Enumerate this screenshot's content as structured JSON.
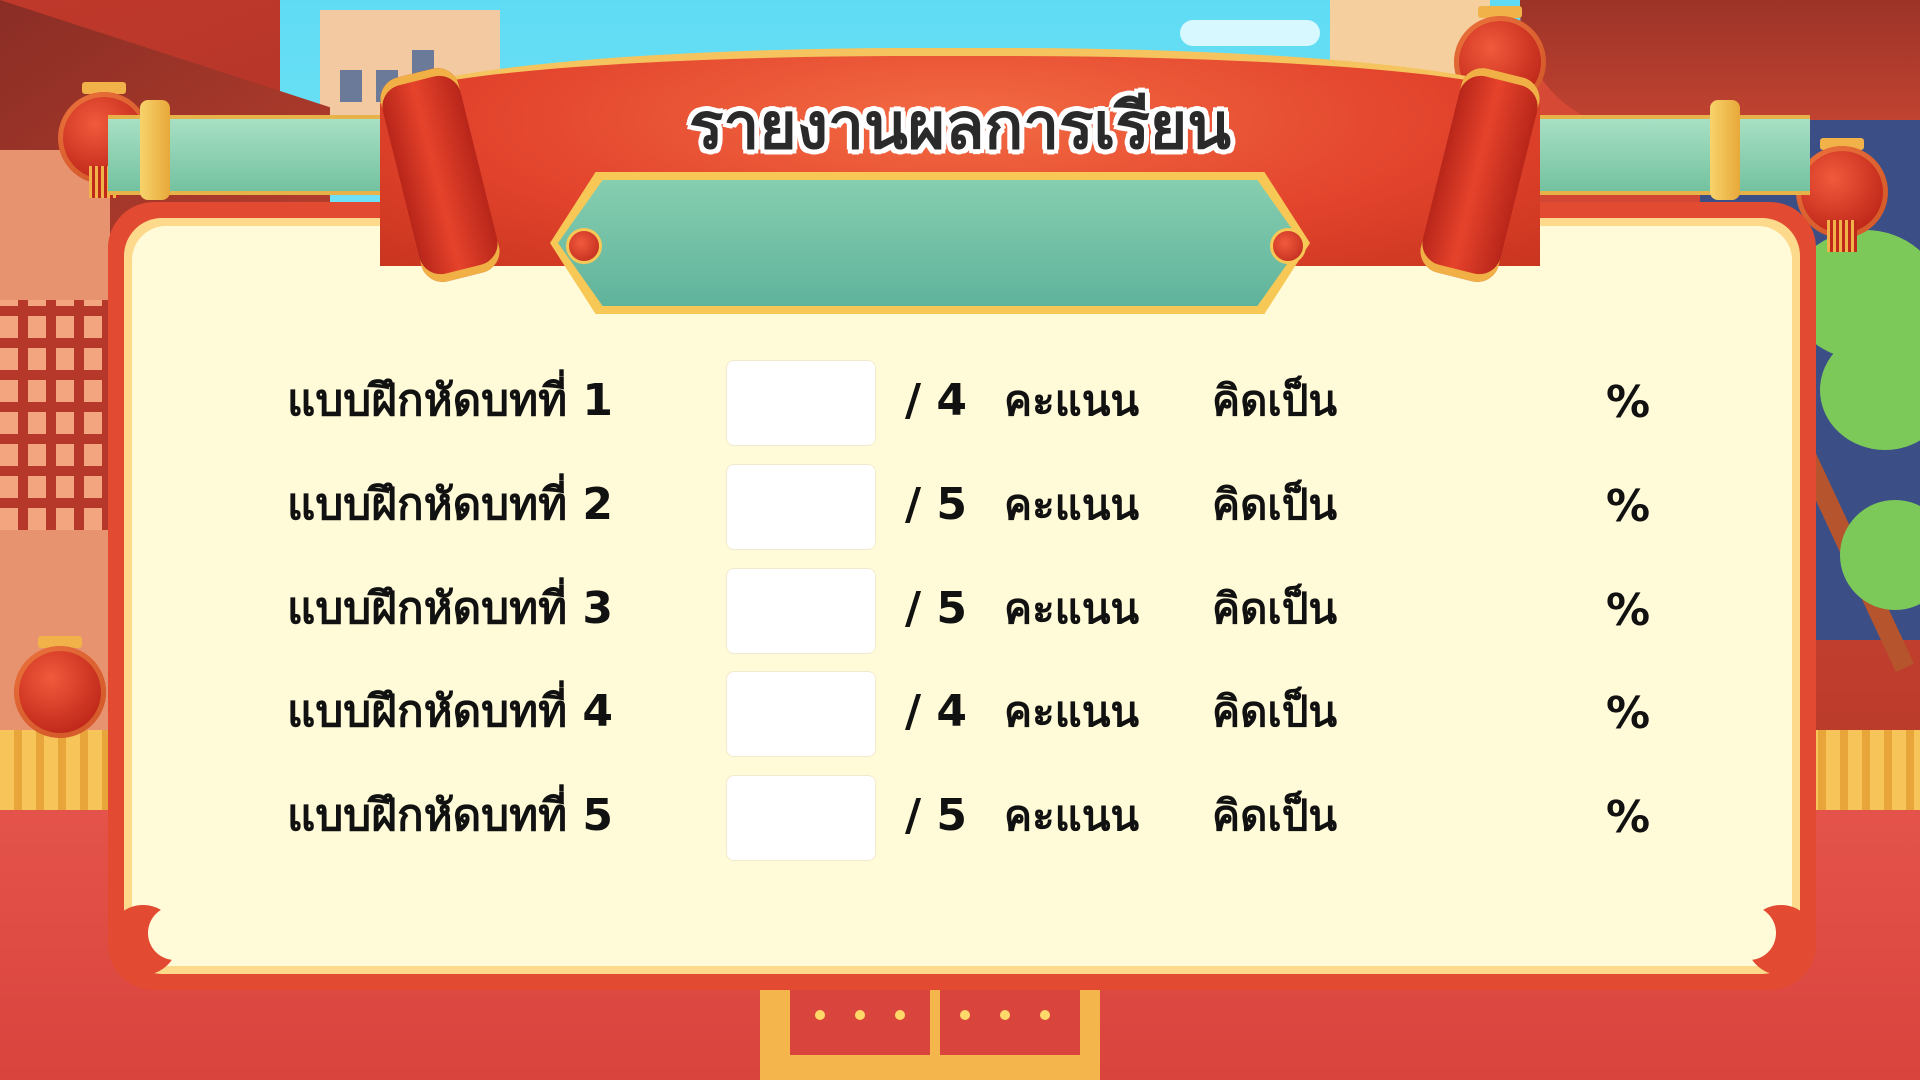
{
  "header": {
    "title": "รายงานผลการเรียน"
  },
  "report": {
    "rows": [
      {
        "lesson": "แบบฝึกหัดบทที่ 1",
        "score": "",
        "total": "/ 4",
        "unit": "คะแนน",
        "calc_label": "คิดเป็น",
        "percent_sign": "%"
      },
      {
        "lesson": "แบบฝึกหัดบทที่ 2",
        "score": "",
        "total": "/ 5",
        "unit": "คะแนน",
        "calc_label": "คิดเป็น",
        "percent_sign": "%"
      },
      {
        "lesson": "แบบฝึกหัดบทที่ 3",
        "score": "",
        "total": "/ 5",
        "unit": "คะแนน",
        "calc_label": "คิดเป็น",
        "percent_sign": "%"
      },
      {
        "lesson": "แบบฝึกหัดบทที่ 4",
        "score": "",
        "total": "/ 4",
        "unit": "คะแนน",
        "calc_label": "คิดเป็น",
        "percent_sign": "%"
      },
      {
        "lesson": "แบบฝึกหัดบทที่ 5",
        "score": "",
        "total": "/ 5",
        "unit": "คะแนน",
        "calc_label": "คิดเป็น",
        "percent_sign": "%"
      }
    ]
  },
  "theme": {
    "panel_border": "#e24a32",
    "panel_fill": "#fffbd8",
    "plaque": "#6fbfa3",
    "sky": "#6fe2f6"
  }
}
